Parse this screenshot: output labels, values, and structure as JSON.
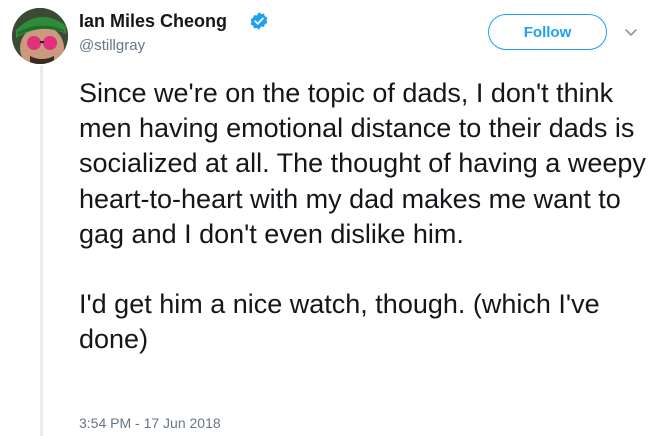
{
  "tweet": {
    "author": {
      "display_name": "Ian Miles Cheong",
      "handle": "@stillgray",
      "verified": true
    },
    "follow_label": "Follow",
    "paragraphs": [
      "Since we're on the topic of dads, I don't think men having emotional distance to their dads is socialized at all. The thought of having a weepy heart-to-heart with my dad makes me want to gag and I don't even dislike him.",
      "I'd get him a nice watch, though. (which I've done)"
    ],
    "timestamp": "3:54 PM - 17 Jun 2018"
  },
  "icons": {
    "verified": "verified-badge-icon",
    "caret": "chevron-down-icon"
  },
  "colors": {
    "accent": "#1da1f2",
    "text": "#14171a",
    "muted": "#657786",
    "thread_line": "#e6ecf0"
  }
}
